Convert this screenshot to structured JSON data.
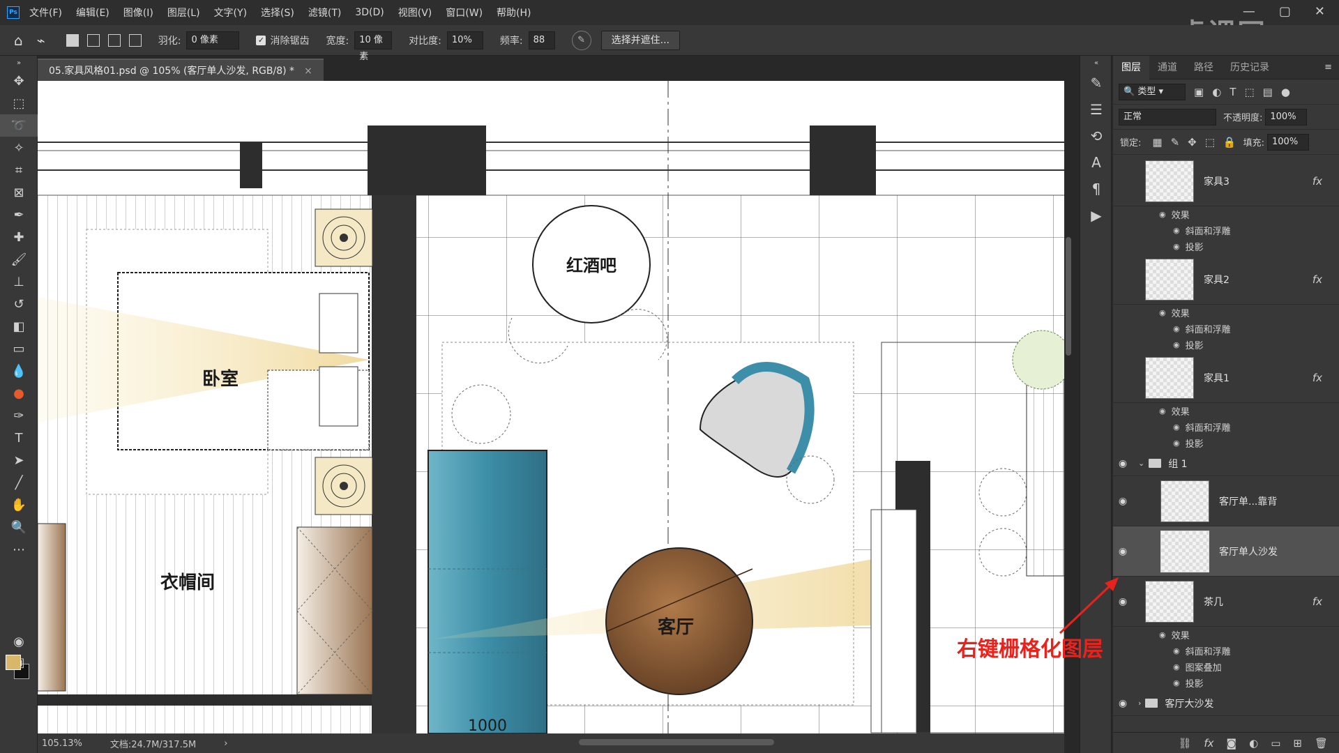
{
  "app": {
    "logo": "Ps"
  },
  "menu": [
    "文件(F)",
    "编辑(E)",
    "图像(I)",
    "图层(L)",
    "文字(Y)",
    "选择(S)",
    "滤镜(T)",
    "3D(D)",
    "视图(V)",
    "窗口(W)",
    "帮助(H)"
  ],
  "options": {
    "feather_label": "羽化:",
    "feather_value": "0 像素",
    "antialias_label": "消除锯齿",
    "width_label": "宽度:",
    "width_value": "10 像素",
    "contrast_label": "对比度:",
    "contrast_value": "10%",
    "frequency_label": "频率:",
    "frequency_value": "88",
    "select_mask_label": "选择并遮住..."
  },
  "document": {
    "tab_title": "05.家具风格01.psd @ 105% (客厅单人沙发, RGB/8) *",
    "close": "×"
  },
  "drawing": {
    "room_bedroom": "卧室",
    "room_wine_bar": "红酒吧",
    "room_closet": "衣帽间",
    "room_living": "客厅",
    "dim_text": "1000"
  },
  "status": {
    "zoom": "105.13%",
    "doc_size": "文档:24.7M/317.5M",
    "arrow": "›"
  },
  "panel": {
    "tabs": [
      "图层",
      "通道",
      "路径",
      "历史记录"
    ],
    "filter_type": "类型",
    "blend_mode": "正常",
    "opacity_label": "不透明度:",
    "opacity_value": "100%",
    "lock_label": "锁定:",
    "fill_label": "填充:",
    "fill_value": "100%",
    "effects_label": "效果",
    "fx_bevel": "斜面和浮雕",
    "fx_shadow": "投影",
    "fx_pattern": "图案叠加",
    "layers": [
      {
        "name": "家具3"
      },
      {
        "name": "家具2"
      },
      {
        "name": "家具1"
      },
      {
        "name": "组 1"
      },
      {
        "name": "客厅单...靠背"
      },
      {
        "name": "客厅单人沙发"
      },
      {
        "name": "茶几"
      },
      {
        "name": "客厅大沙发"
      }
    ]
  },
  "annotation": "右键栅格化图层",
  "watermark": "虎课网",
  "colors": {
    "accent_red": "#e8231d",
    "foreground": "#d9b76a",
    "sofa_blue": "#4a9ab0",
    "table_brown": "#8a5a35"
  }
}
